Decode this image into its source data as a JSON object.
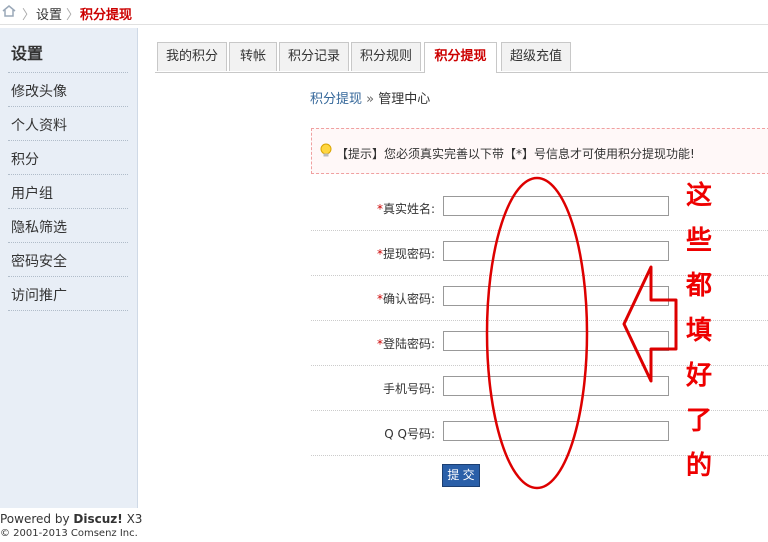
{
  "breadcrumb": {
    "item1": "设置",
    "current": "积分提现",
    "sep": "〉"
  },
  "sidebar": {
    "title": "设置",
    "items": [
      "修改头像",
      "个人资料",
      "积分",
      "用户组",
      "隐私筛选",
      "密码安全",
      "访问推广"
    ]
  },
  "tabs": [
    "我的积分",
    "转帐",
    "积分记录",
    "积分规则",
    "积分提现",
    "超级充值"
  ],
  "sub_nav": {
    "link": "积分提现",
    "sep": "»",
    "current": "管理中心"
  },
  "notice": "【提示】您必须真实完善以下带【*】号信息才可使用积分提现功能!",
  "form": {
    "star": "*",
    "fields": [
      {
        "label": "真实姓名:",
        "required": true
      },
      {
        "label": "提现密码:",
        "required": true
      },
      {
        "label": "确认密码:",
        "required": true
      },
      {
        "label": "登陆密码:",
        "required": true
      },
      {
        "label": "手机号码:",
        "required": false
      },
      {
        "label": "Q Q号码:",
        "required": false
      }
    ],
    "submit": "提 交"
  },
  "annotation": [
    "这",
    "些",
    "都",
    "填",
    "好",
    "了",
    "的"
  ],
  "footer": {
    "powered": "Powered by",
    "brand": "Discuz!",
    "version": "X3",
    "copyright": "© 2001-2013 Comsenz Inc."
  },
  "colors": {
    "accent_red": "#cc0000",
    "annotation_red": "#ee0000",
    "button_blue": "#2a5fa8",
    "sidebar_bg": "#e8eef6"
  }
}
